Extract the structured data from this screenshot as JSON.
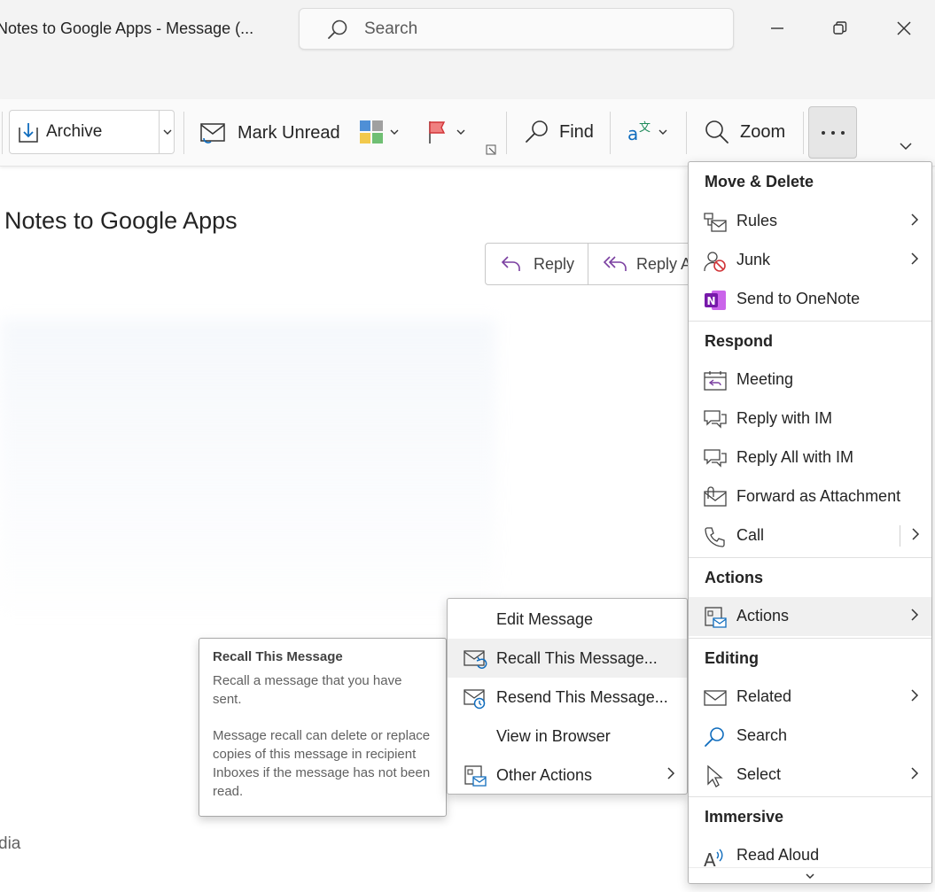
{
  "window": {
    "title": "Notes to Google Apps  -  Message (...",
    "search_placeholder": "Search"
  },
  "ribbon": {
    "archive_label": "Archive",
    "mark_unread_label": "Mark Unread",
    "find_label": "Find",
    "zoom_label": "Zoom"
  },
  "message": {
    "subject": "Notes to Google Apps",
    "reply_label": "Reply",
    "reply_all_label": "Reply A",
    "footer_fragment": "dia"
  },
  "main_menu": {
    "sections": {
      "move_delete": "Move & Delete",
      "respond": "Respond",
      "actions": "Actions",
      "editing": "Editing",
      "immersive": "Immersive"
    },
    "items": {
      "rules": "Rules",
      "junk": "Junk",
      "send_to_onenote": "Send to OneNote",
      "meeting": "Meeting",
      "reply_with_im": "Reply with IM",
      "reply_all_with_im": "Reply All with IM",
      "forward_as_attachment": "Forward as Attachment",
      "call": "Call",
      "actions": "Actions",
      "related": "Related",
      "search": "Search",
      "select": "Select",
      "read_aloud": "Read Aloud"
    }
  },
  "sub_menu": {
    "edit_message": "Edit Message",
    "recall_this_message": "Recall This Message...",
    "resend_this_message": "Resend This Message...",
    "view_in_browser": "View in Browser",
    "other_actions": "Other Actions"
  },
  "tooltip": {
    "title": "Recall This Message",
    "line1": "Recall a message that you have sent.",
    "line2": "Message recall can delete or replace copies of this message in recipient Inboxes if the message has not been read."
  },
  "colors": {
    "accent_blue": "#0f6cbd",
    "onenote_purple": "#7719aa",
    "flag_red": "#d13438",
    "menu_hover": "#f0f0f0"
  }
}
